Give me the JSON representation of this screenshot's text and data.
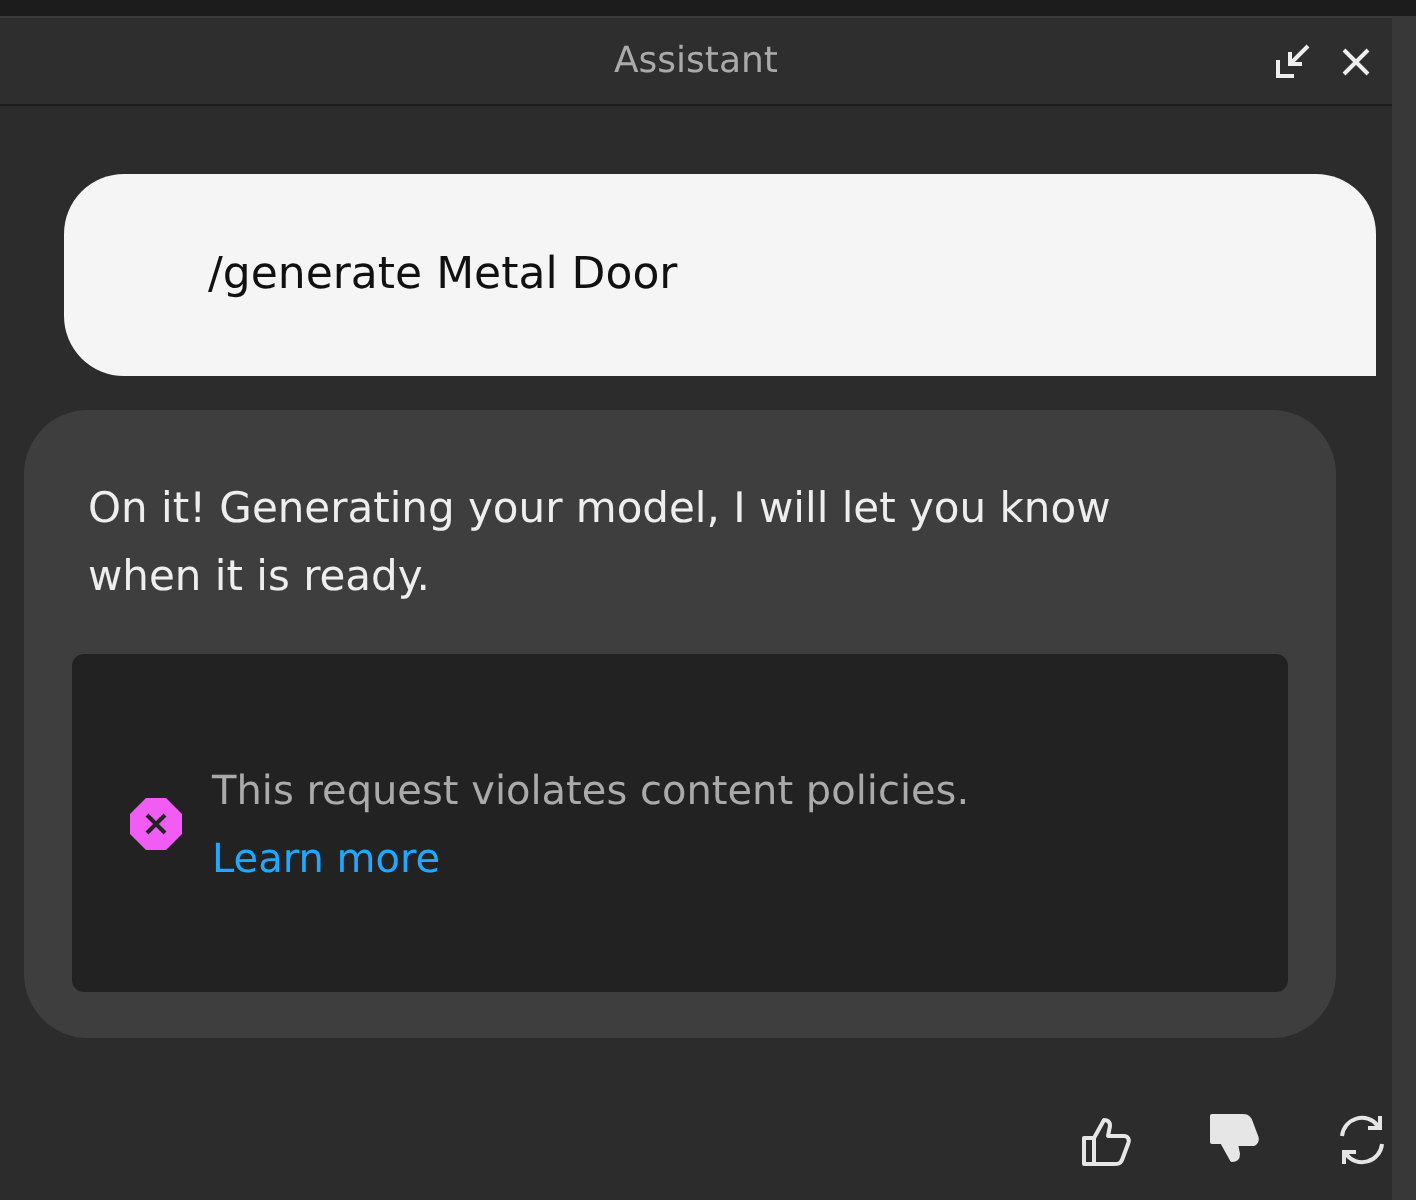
{
  "window": {
    "title": "Assistant"
  },
  "messages": [
    {
      "kind": "user",
      "text": "/generate Metal Door"
    },
    {
      "kind": "assistant",
      "text": "On it! Generating your model, I will let you know when it is ready.",
      "notice": {
        "kind": "error",
        "text": "This request violates content policies.",
        "link": "Learn more"
      }
    }
  ],
  "feedback": {
    "liked": false,
    "disliked": true
  }
}
